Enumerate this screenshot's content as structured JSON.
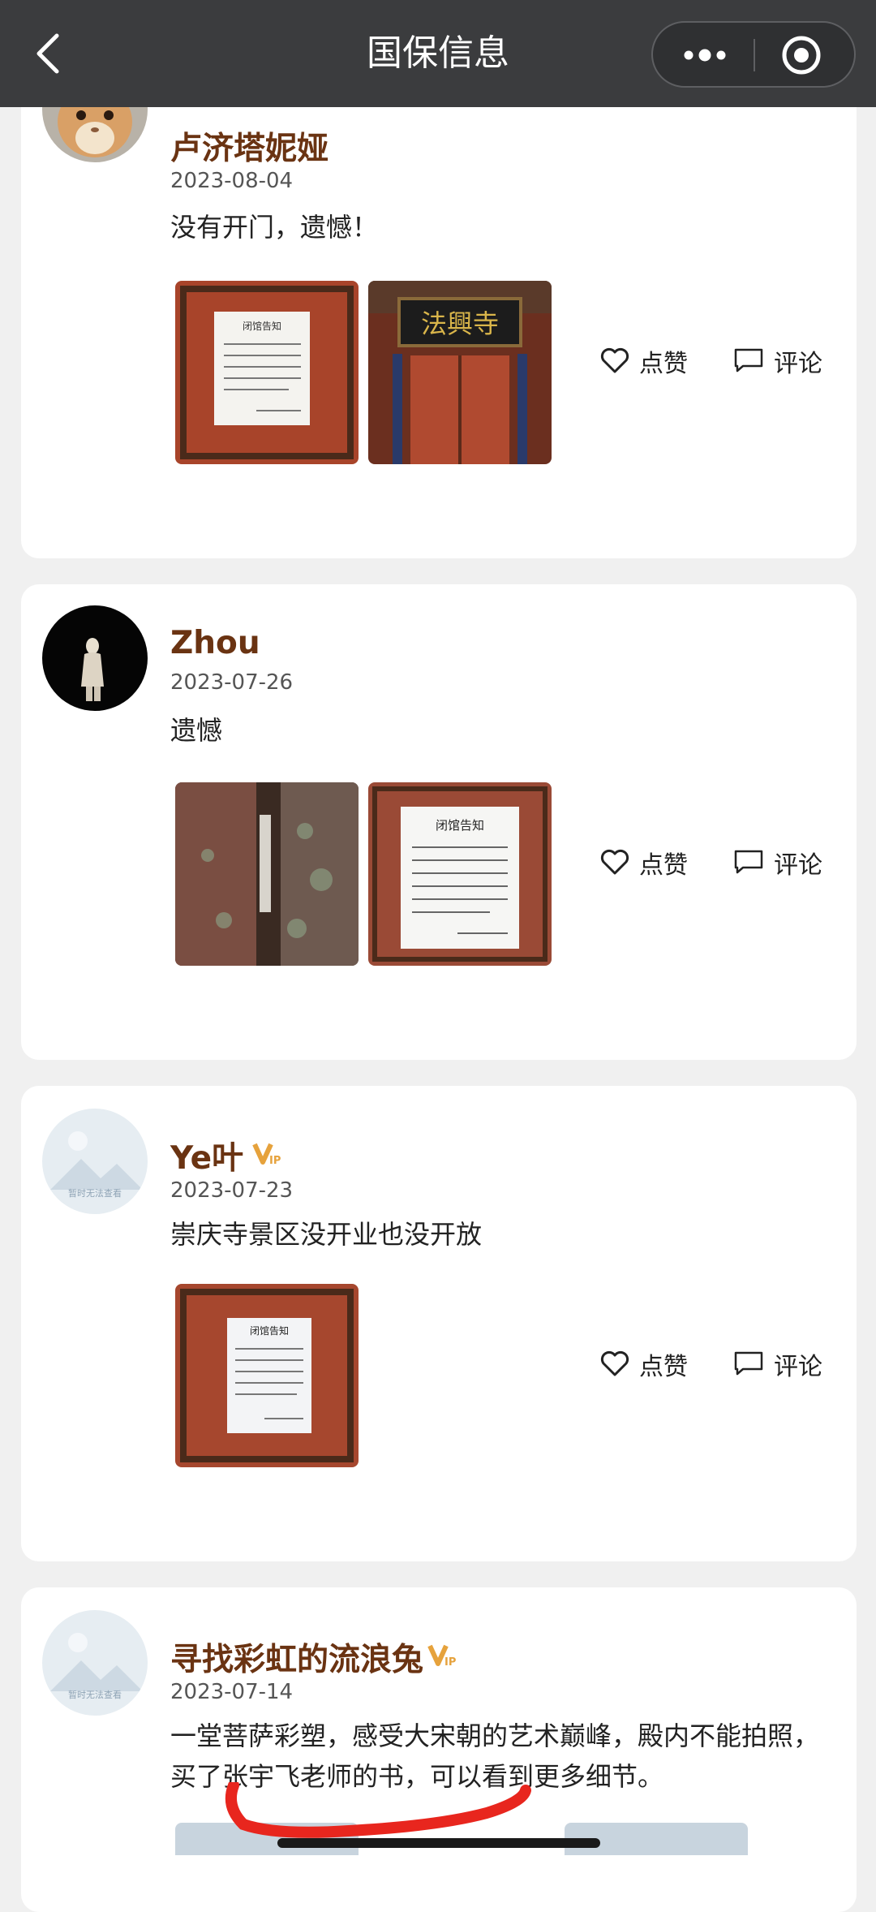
{
  "navbar": {
    "title": "国保信息"
  },
  "posts": [
    {
      "username": "卢济塔妮娅",
      "date": "2023-08-04",
      "content": "没有开门，遗憾！",
      "vip": false,
      "images": [
        "closure-notice-photo",
        "temple-gate-plaque-photo"
      ],
      "like_label": "点赞",
      "comment_label": "评论"
    },
    {
      "username": "Zhou",
      "date": "2023-07-26",
      "content": "遗憾",
      "vip": false,
      "images": [
        "door-gap-photo",
        "closure-notice-photo"
      ],
      "like_label": "点赞",
      "comment_label": "评论"
    },
    {
      "username": "Ye叶",
      "date": "2023-07-23",
      "content": "崇庆寺景区没开业也没开放",
      "vip": true,
      "avatar_placeholder_text": "暂时无法查看",
      "images": [
        "closure-notice-photo"
      ],
      "like_label": "点赞",
      "comment_label": "评论"
    },
    {
      "username": "寻找彩虹的流浪兔",
      "date": "2023-07-14",
      "content": "一堂菩萨彩塑，感受大宋朝的艺术巅峰，殿内不能拍照，买了张宇飞老师的书，可以看到更多细节。",
      "vip": true,
      "avatar_placeholder_text": "暂时无法查看"
    }
  ],
  "notice_sign": {
    "title": "闭馆告知"
  },
  "plaque_text": "法興寺",
  "colors": {
    "navbar_bg": "#3b3c3e",
    "username": "#6a3312",
    "vip_badge": "#e6a23c",
    "annotation_stroke": "#e8261e"
  }
}
